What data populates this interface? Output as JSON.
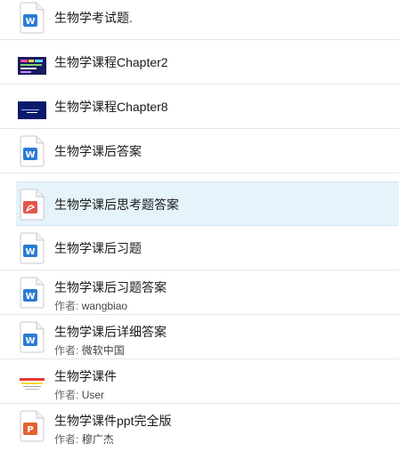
{
  "author_prefix": "作者:",
  "items": [
    {
      "title": "生物学考试题.",
      "icon": "word-doc-icon",
      "author": ""
    },
    {
      "title": "生物学课程Chapter2",
      "icon": "slide-thumbnail-icon",
      "author": ""
    },
    {
      "title": "生物学课程Chapter8",
      "icon": "slide-thumbnail-icon",
      "author": ""
    },
    {
      "title": "生物学课后答案",
      "icon": "word-doc-icon",
      "author": ""
    },
    {
      "title": "生物学课后思考题答案",
      "icon": "pdf-doc-icon",
      "author": ""
    },
    {
      "title": "生物学课后习题",
      "icon": "word-doc-icon",
      "author": ""
    },
    {
      "title": "生物学课后习题答案",
      "icon": "word-doc-icon",
      "author": "wangbiao"
    },
    {
      "title": "生物学课后详细答案",
      "icon": "word-doc-icon",
      "author": "微软中国"
    },
    {
      "title": "生物学课件",
      "icon": "slide-thumbnail-icon",
      "author": "User"
    },
    {
      "title": "生物学课件ppt完全版",
      "icon": "ppt-doc-icon",
      "author": "穆广杰"
    }
  ],
  "colors": {
    "word": "#2b7cd3",
    "pdf": "#e2574c",
    "ppt": "#e2622e",
    "selected_bg": "#e5f3fb"
  }
}
